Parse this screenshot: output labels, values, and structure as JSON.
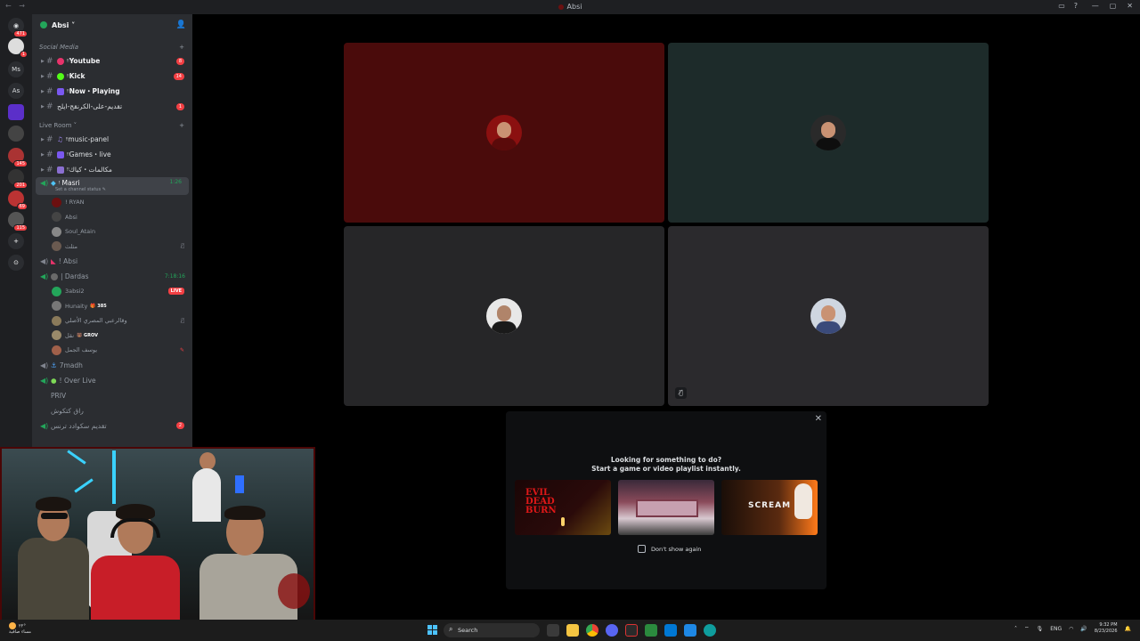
{
  "window": {
    "title": "Absi",
    "nav": "← →"
  },
  "servers": [
    {
      "label": "",
      "badge": "471"
    },
    {
      "label": "",
      "badge": "1"
    },
    {
      "label": "Ms",
      "badge": ""
    },
    {
      "label": "As",
      "badge": ""
    },
    {
      "label": "",
      "badge": ""
    },
    {
      "label": "",
      "badge": ""
    },
    {
      "label": "",
      "badge": "145"
    },
    {
      "label": "",
      "badge": "201"
    },
    {
      "label": "",
      "badge": "69"
    },
    {
      "label": "",
      "badge": "115"
    }
  ],
  "server": {
    "name": "Absi ˅"
  },
  "categories": {
    "social": "Social Media",
    "live": "Live Room ˅"
  },
  "text_channels": [
    {
      "name": "Youtube",
      "prefix": "ᵎᵎ",
      "count": "8",
      "color": "#e8336b"
    },
    {
      "name": "Kick",
      "prefix": "ᵎᵎ",
      "count": "14",
      "color": "#53fc18"
    },
    {
      "name": "Now・Playing",
      "prefix": "ᵎᵎ",
      "count": "",
      "color": "#7a58f0"
    },
    {
      "name": "تقديم-على-الكرنقج-ايلح",
      "prefix": "",
      "count": "1",
      "color": ""
    }
  ],
  "live_channels": [
    {
      "name": "music-panel",
      "prefix": "ᵎᵎ"
    },
    {
      "name": "Games・live",
      "prefix": "ᵎᵎ"
    },
    {
      "name": "مكالمات・كياك",
      "prefix": "ᵎᵎ"
    }
  ],
  "voice": {
    "masri": {
      "name": "ᵎ Masri",
      "time": "1:26",
      "status": "Set a channel status ✎"
    },
    "masri_users": [
      "! RYAN",
      "Absi",
      "Soul_Atain",
      "مثلث"
    ],
    "absi": {
      "name": "! Absi"
    },
    "dardas": {
      "name": "| Dardas",
      "time": "7:18:16"
    },
    "dardas_users": [
      {
        "name": "3absi2",
        "tag": "",
        "live": "LIVE"
      },
      {
        "name": "Hunaity",
        "tag": "🎁 385",
        "live": ""
      },
      {
        "name": "وقالرعبي المصري الأصلي",
        "tag": "",
        "live": ""
      },
      {
        "name": "نقل",
        "tag": "🐻 GROV",
        "live": ""
      },
      {
        "name": "يوسف الجمل",
        "tag": "",
        "live": ""
      }
    ],
    "others": [
      "7madh",
      "! Over Live",
      "PRIV",
      "راق كتكوش",
      "تقديم سكوادد ترنس"
    ],
    "last_badge": "2"
  },
  "tiles": [
    {
      "bg": "#4a0b0b",
      "avatar": "ryan"
    },
    {
      "bg": "#1d2b2a",
      "avatar": "suit"
    },
    {
      "bg": "#262628",
      "avatar": "cap"
    },
    {
      "bg": "#2b2a2d",
      "avatar": "face"
    }
  ],
  "activity": {
    "close": "✕",
    "line1": "Looking for something to do?",
    "line2": "Start a game or video playlist instantly.",
    "games": [
      {
        "title": "EVIL DEAD BURN",
        "colors": [
          "#1a0606",
          "#cc1010"
        ]
      },
      {
        "title": "",
        "colors": [
          "#2a1a2e",
          "#e05b8a"
        ]
      },
      {
        "title": "SCREAM",
        "colors": [
          "#1a0e08",
          "#ff7a1a"
        ]
      }
    ],
    "checkbox_label": "Don't show again"
  },
  "taskbar": {
    "weather": "مساء صافية",
    "temp": "٢٢°",
    "search": "Search",
    "lang": "ENG",
    "time": "9:32 PM",
    "date": "8/23/2026"
  }
}
